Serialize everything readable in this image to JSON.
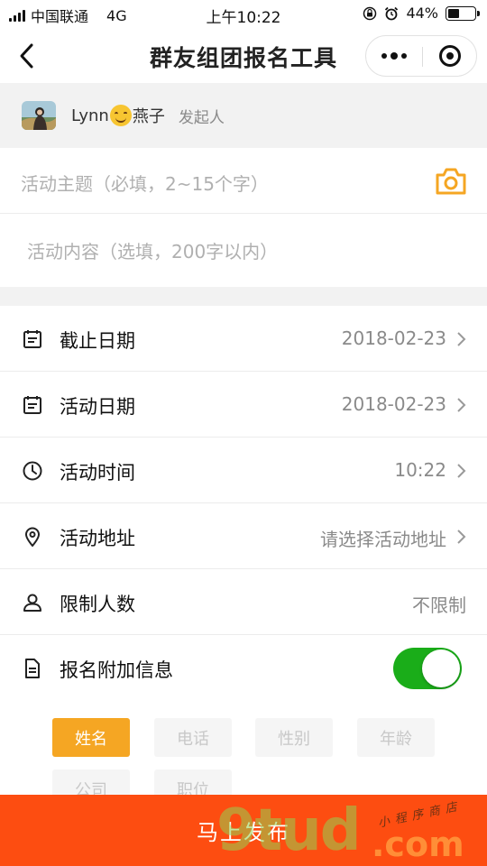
{
  "status_bar": {
    "carrier": "中国联通",
    "network": "4G",
    "time": "上午10:22",
    "battery": "44%",
    "battery_level": 0.44
  },
  "nav": {
    "title": "群友组团报名工具"
  },
  "initiator": {
    "name_part1": "Lynn",
    "name_part2": "燕子",
    "role": "发起人"
  },
  "topic": {
    "placeholder": "活动主题（必填，2~15个字）"
  },
  "content": {
    "placeholder": "活动内容（选填，200字以内）"
  },
  "settings": [
    {
      "icon": "calendar-icon",
      "label": "截止日期",
      "value": "2018-02-23"
    },
    {
      "icon": "calendar-icon",
      "label": "活动日期",
      "value": "2018-02-23"
    },
    {
      "icon": "clock-icon",
      "label": "活动时间",
      "value": "10:22"
    },
    {
      "icon": "location-pin-icon",
      "label": "活动地址",
      "value": "请选择活动地址"
    },
    {
      "icon": "user-icon",
      "label": "限制人数",
      "value": "不限制"
    },
    {
      "icon": "document-icon",
      "label": "报名附加信息",
      "toggle_on": true
    }
  ],
  "tags": [
    "姓名",
    "电话",
    "性别",
    "年龄",
    "公司",
    "职位"
  ],
  "tags_selected": "姓名",
  "publish": "马上发布",
  "watermark": {
    "main": "9tud",
    "domain": ".com",
    "small": "小程序商店"
  },
  "colors": {
    "accent_orange": "#f5a623",
    "toggle_green": "#1aad19",
    "bottom_bar": "#fd4d11"
  }
}
